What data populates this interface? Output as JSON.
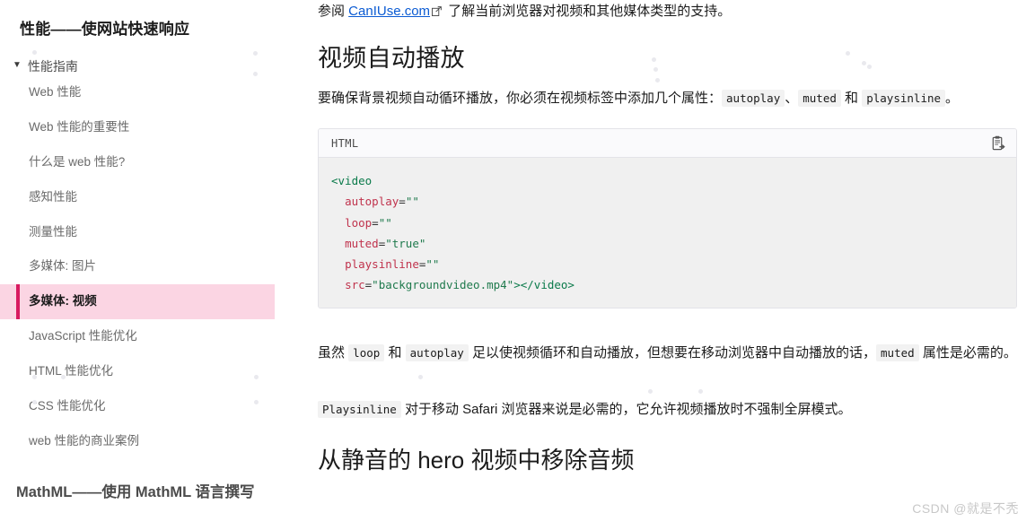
{
  "sidebar": {
    "title": "性能——使网站快速响应",
    "group": {
      "label": "性能指南",
      "toggle_glyph": "▼"
    },
    "items": [
      {
        "label": "Web 性能",
        "active": false
      },
      {
        "label": "Web 性能的重要性",
        "active": false
      },
      {
        "label": "什么是 web 性能?",
        "active": false
      },
      {
        "label": "感知性能",
        "active": false
      },
      {
        "label": "测量性能",
        "active": false
      },
      {
        "label": "多媒体: 图片",
        "active": false
      },
      {
        "label": "多媒体: 视频",
        "active": true
      },
      {
        "label": "JavaScript 性能优化",
        "active": false
      },
      {
        "label": "HTML 性能优化",
        "active": false
      },
      {
        "label": "CSS 性能优化",
        "active": false
      },
      {
        "label": "web 性能的商业案例",
        "active": false
      }
    ],
    "bottom_section_title": "MathML——使用 MathML 语言撰写",
    "accent_color": "#d81a60",
    "active_bg_color": "#fbd5e3"
  },
  "content": {
    "intro": {
      "before_link": "参阅 ",
      "link_text": "CanIUse.com",
      "after_link": " 了解当前浏览器对视频和其他媒体类型的支持。"
    },
    "heading_autoplay": "视频自动播放",
    "paragraph_attrs": {
      "part1": "要确保背景视频自动循环播放，你必须在视频标签中添加几个属性：",
      "code1": "autoplay",
      "sep1": "、",
      "code2": "muted",
      "sep2": " 和 ",
      "code3": "playsinline",
      "end": "。"
    },
    "codeblock": {
      "language": "HTML",
      "copy_icon": "clipboard-copy-icon",
      "lines": [
        {
          "tag": "<video"
        },
        {
          "indent": "  ",
          "attr": "autoplay",
          "eq": "=",
          "str": "\"\""
        },
        {
          "indent": "  ",
          "attr": "loop",
          "eq": "=",
          "str": "\"\""
        },
        {
          "indent": "  ",
          "attr": "muted",
          "eq": "=",
          "str": "\"true\""
        },
        {
          "indent": "  ",
          "attr": "playsinline",
          "eq": "=",
          "str": "\"\""
        },
        {
          "indent": "  ",
          "attr": "src",
          "eq": "=",
          "str": "\"backgroundvideo.mp4\"",
          "closer": "></video>"
        }
      ]
    },
    "paragraph_loop": {
      "part1": "虽然 ",
      "code1": "loop",
      "part2": " 和 ",
      "code2": "autoplay",
      "part3": " 足以使视频循环和自动播放，但想要在移动浏览器中自动播放的话，",
      "code3": "muted",
      "part4": " 属性是必需的。"
    },
    "paragraph_playsinline": {
      "code1": "Playsinline",
      "text": " 对于移动 Safari 浏览器来说是必需的，它允许视频播放时不强制全屏模式。"
    },
    "heading_remove_audio": "从静音的 hero 视频中移除音频"
  },
  "watermark": "CSDN @就是不秃",
  "link_color": "#0b5bd3"
}
